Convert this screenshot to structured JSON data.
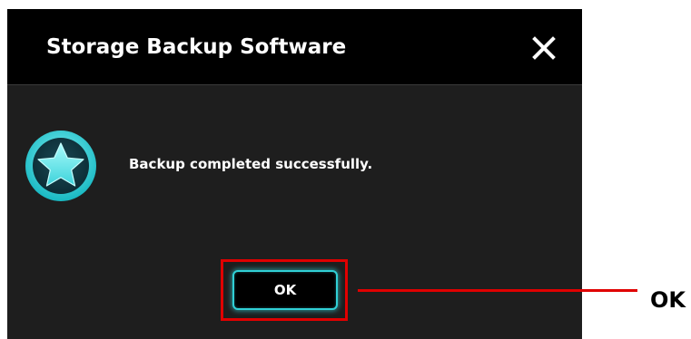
{
  "dialog": {
    "title": "Storage Backup Software",
    "close_icon": "close-icon",
    "status_icon": "star-icon",
    "message": "Backup completed successfully.",
    "ok_label": "OK"
  },
  "annotation": {
    "label": "OK",
    "highlight_color": "#e00000"
  },
  "colors": {
    "titlebar": "#000000",
    "body": "#1e1e1e",
    "accent": "#30d0d6"
  }
}
